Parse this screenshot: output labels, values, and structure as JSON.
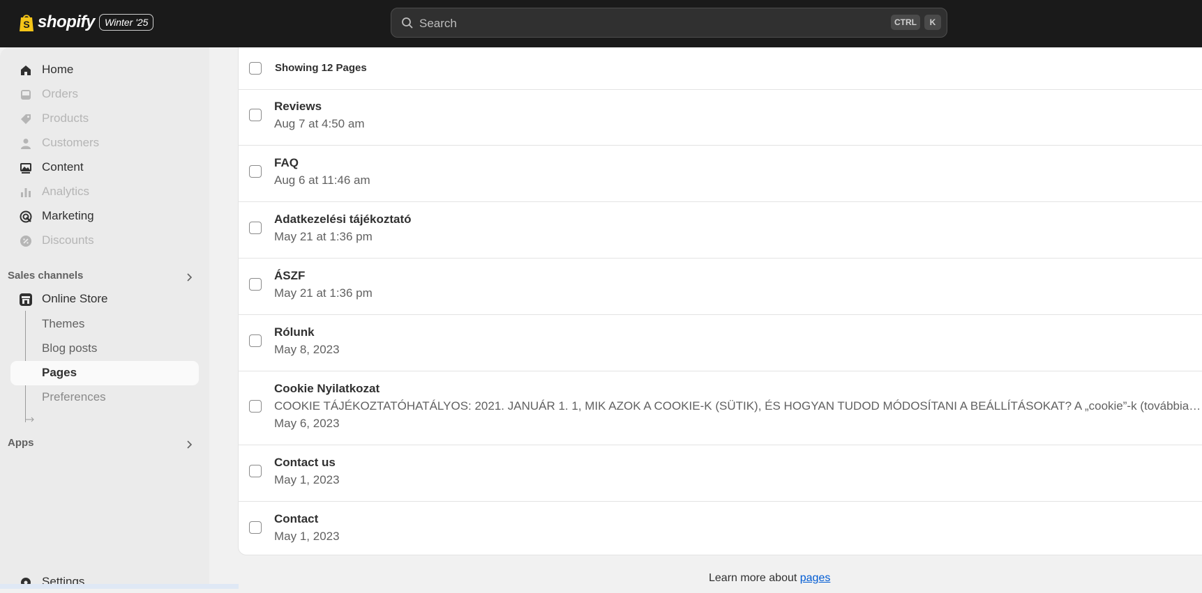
{
  "brand": {
    "name": "shopify",
    "badge": "Winter '25"
  },
  "search": {
    "placeholder": "Search",
    "shortcut_keys": [
      "CTRL",
      "K"
    ]
  },
  "nav": {
    "items": [
      {
        "label": "Home",
        "icon": "home-icon",
        "state": "active"
      },
      {
        "label": "Orders",
        "icon": "orders-inbox-icon",
        "state": "disabled"
      },
      {
        "label": "Products",
        "icon": "tag-icon",
        "state": "disabled"
      },
      {
        "label": "Customers",
        "icon": "person-icon",
        "state": "disabled"
      },
      {
        "label": "Content",
        "icon": "content-image-icon",
        "state": "active"
      },
      {
        "label": "Analytics",
        "icon": "bar-chart-icon",
        "state": "disabled"
      },
      {
        "label": "Marketing",
        "icon": "target-icon",
        "state": "active"
      },
      {
        "label": "Discounts",
        "icon": "discount-badge-icon",
        "state": "disabled"
      }
    ],
    "sales_channels": {
      "heading": "Sales channels",
      "online_store": "Online Store",
      "sub_items": [
        "Themes",
        "Blog posts",
        "Pages",
        "Preferences"
      ],
      "selected": "Pages"
    },
    "apps_heading": "Apps",
    "settings": "Settings"
  },
  "list": {
    "header": "Showing 12 Pages",
    "rows": [
      {
        "title": "Reviews",
        "date": "Aug 7 at 4:50 am"
      },
      {
        "title": "FAQ",
        "date": "Aug 6 at 11:46 am"
      },
      {
        "title": "Adatkezelési tájékoztató",
        "date": "May 21 at 1:36 pm"
      },
      {
        "title": "ÁSZF",
        "date": "May 21 at 1:36 pm"
      },
      {
        "title": "Rólunk",
        "date": "May 8, 2023"
      },
      {
        "title": "Cookie Nyilatkozat",
        "description": "COOKIE TÁJÉKOZTATÓHATÁLYOS: 2021. JANUÁR 1. 1, MIK AZOK A COOKIE-K (SÜTIK), ÉS HOGYAN TUDOD MÓDOSÍTANI A BEÁLLÍTÁSOKAT? A „cookie”-k (továbbiakban:...",
        "date": "May 6, 2023"
      },
      {
        "title": "Contact us",
        "date": "May 1, 2023"
      },
      {
        "title": "Contact",
        "date": "May 1, 2023"
      }
    ]
  },
  "footer": {
    "text": "Learn more about ",
    "link": "pages"
  },
  "colors": {
    "topbar": "#1a1a1a",
    "sidebar": "#ebebeb",
    "link": "#005bd3"
  }
}
